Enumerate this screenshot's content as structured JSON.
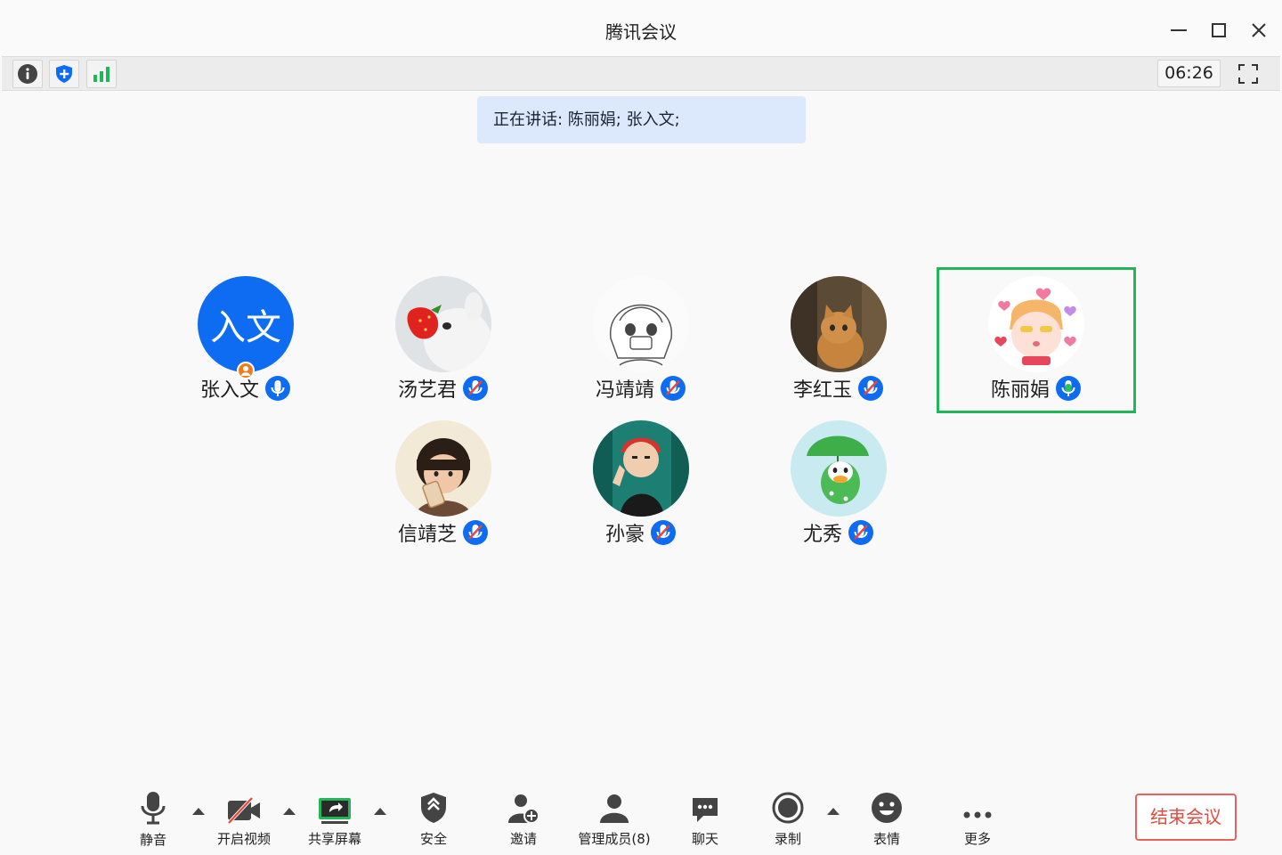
{
  "window": {
    "title": "腾讯会议"
  },
  "toolbar": {
    "timer": "06:26"
  },
  "speaking": {
    "text": "正在讲话: 陈丽娟; 张入文;"
  },
  "participants": [
    {
      "name": "张入文",
      "avatar_text": "入文",
      "mic": "on",
      "host": true
    },
    {
      "name": "汤艺君",
      "avatar": "white-cat-with-strawberry",
      "mic": "muted"
    },
    {
      "name": "冯靖靖",
      "avatar": "manga-girl-sketch",
      "mic": "muted"
    },
    {
      "name": "李红玉",
      "avatar": "orange-cat",
      "mic": "muted"
    },
    {
      "name": "陈丽娟",
      "avatar": "cartoon-character-with-hearts",
      "mic": "speaking",
      "active": true
    },
    {
      "name": "信靖芝",
      "avatar": "child-drinking",
      "mic": "muted"
    },
    {
      "name": "孙豪",
      "avatar": "anime-redhead",
      "mic": "muted"
    },
    {
      "name": "尤秀",
      "avatar": "green-duck-umbrella",
      "mic": "muted"
    }
  ],
  "controls": {
    "mute": "静音",
    "video": "开启视频",
    "share": "共享屏幕",
    "security": "安全",
    "invite": "邀请",
    "members": "管理成员(8)",
    "chat": "聊天",
    "record": "录制",
    "reactions": "表情",
    "more": "更多",
    "end": "结束会议"
  },
  "colors": {
    "accent_blue": "#0d6cf2",
    "active_border": "#22b55a",
    "end_red": "#e04b3f",
    "banner_bg": "#dce9fc"
  }
}
